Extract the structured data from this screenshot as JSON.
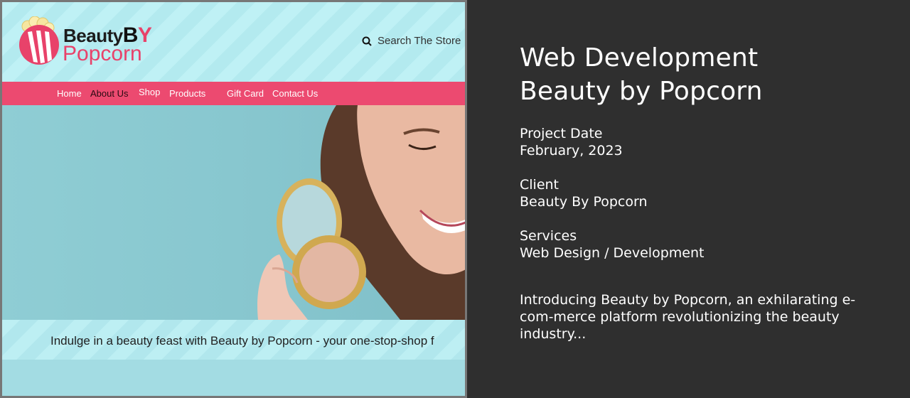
{
  "site": {
    "logo": {
      "line1": "Beauty",
      "line1_by_b": "B",
      "line1_by_y": "Y",
      "line2": "Popcorn"
    },
    "search_label": "Search The Store",
    "nav": [
      "Home",
      "About Us",
      "Shop",
      "Products",
      "Gift Card",
      "Contact Us"
    ],
    "tagline": "Indulge in a beauty feast with Beauty by Popcorn - your one-stop-shop f",
    "colors": {
      "brand_pink": "#ec4a70",
      "header_cyan": "#bff1f5",
      "hero_teal": "#8fcdd4"
    }
  },
  "project": {
    "title_line1": "Web Development",
    "title_line2": "Beauty by Popcorn",
    "date_label": "Project Date",
    "date_value": "February, 2023",
    "client_label": "Client",
    "client_value": "Beauty By Popcorn",
    "services_label": "Services",
    "services_value": "Web Design / Development",
    "intro": "Introducing Beauty by Popcorn, an exhilarating e-com-merce platform revolutionizing the beauty industry..."
  }
}
